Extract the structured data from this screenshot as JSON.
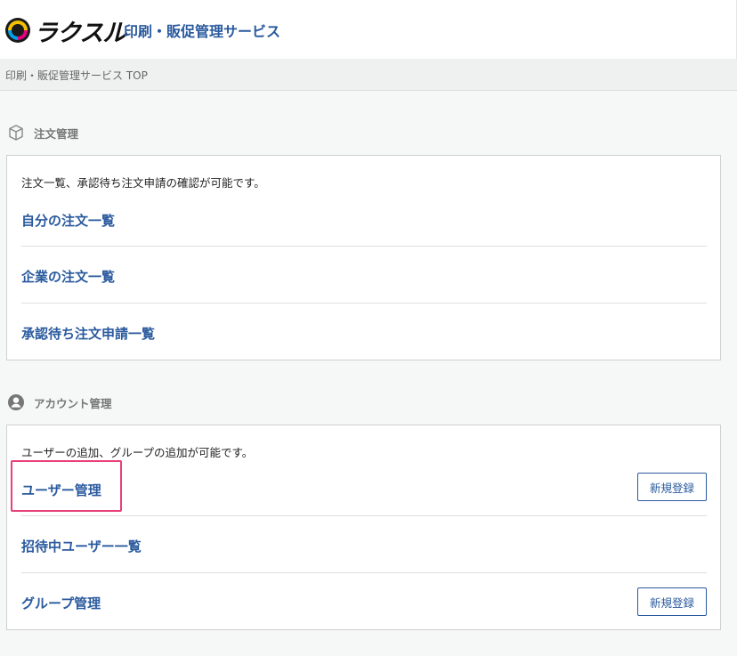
{
  "header": {
    "logo_text": "ラクスル",
    "app_title": "印刷・販促管理サービス"
  },
  "breadcrumb": {
    "current": "印刷・販促管理サービス TOP"
  },
  "order_section": {
    "title": "注文管理",
    "icon": "box-icon",
    "description": "注文一覧、承認待ち注文申請の確認が可能です。",
    "links": [
      {
        "label": "自分の注文一覧"
      },
      {
        "label": "企業の注文一覧"
      },
      {
        "label": "承認待ち注文申請一覧"
      }
    ]
  },
  "account_section": {
    "title": "アカウント管理",
    "icon": "user-circle-icon",
    "description": "ユーザーの追加、グループの追加が可能です。",
    "links": [
      {
        "label": "ユーザー管理",
        "button": "新規登録"
      },
      {
        "label": "招待中ユーザー一覧"
      },
      {
        "label": "グループ管理",
        "button": "新規登録"
      }
    ]
  },
  "colors": {
    "link": "#2a5a9e",
    "highlight": "#e8407a"
  }
}
